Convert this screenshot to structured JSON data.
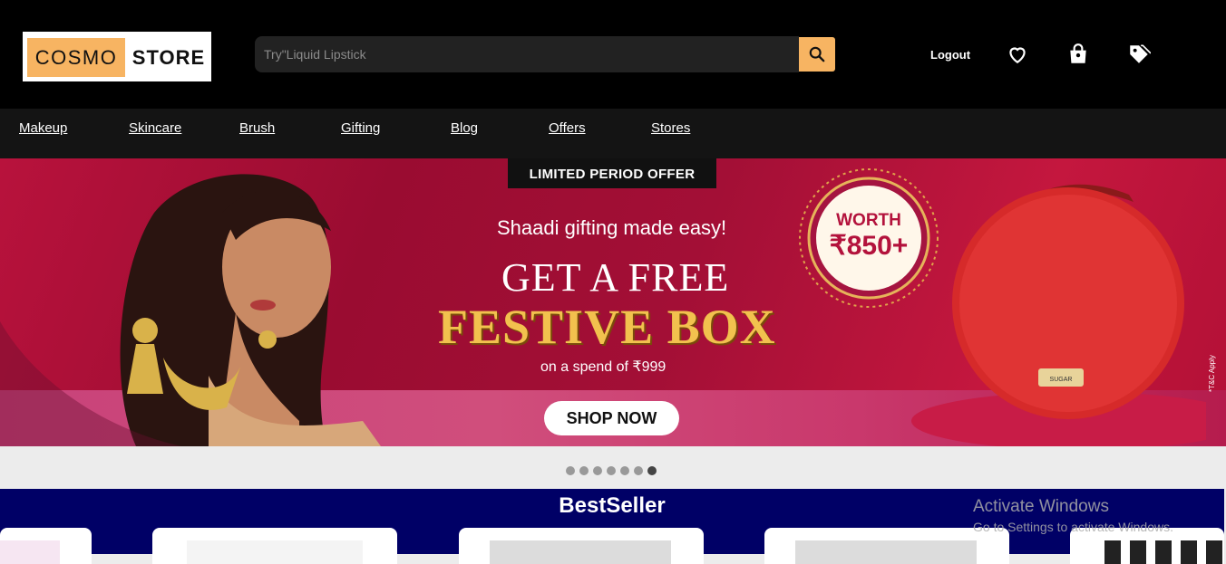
{
  "header": {
    "logo_left": "COSMO",
    "logo_right": "STORE",
    "search_placeholder": "Try\"Liquid Lipstick",
    "logout": "Logout"
  },
  "nav": {
    "items": [
      "Makeup",
      "Skincare",
      "Brush",
      "Gifting",
      "Blog",
      "Offers",
      "Stores"
    ]
  },
  "banner": {
    "badge": "LIMITED PERIOD OFFER",
    "tagline": "Shaadi gifting made easy!",
    "headline": "GET A FREE",
    "headline2": "FESTIVE BOX",
    "spend_text": "on a spend of ₹999",
    "worth_label": "WORTH",
    "worth_value": "₹850+",
    "cta": "SHOP NOW",
    "tnc": "*T&C Apply",
    "bag_brand": "SUGAR"
  },
  "carousel": {
    "total": 7,
    "active": 7
  },
  "bestseller": {
    "title": "BestSeller"
  },
  "watermark": {
    "line1": "Activate Windows",
    "line2": "Go to Settings to activate Windows."
  },
  "colors": {
    "accent": "#f7b462",
    "bestseller_bg": "#000066",
    "banner": "#a30f36"
  }
}
